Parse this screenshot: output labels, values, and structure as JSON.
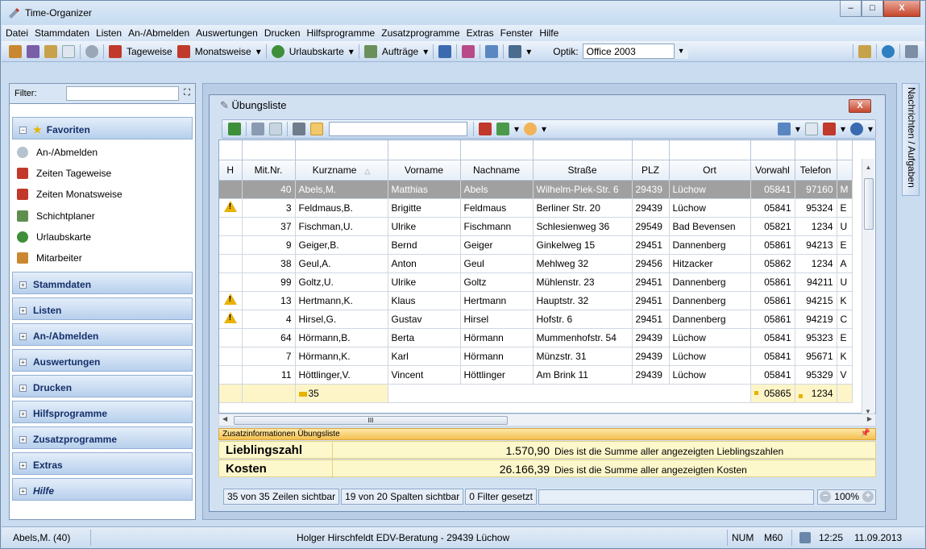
{
  "window": {
    "title": "Time-Organizer",
    "minimize": "–",
    "maximize": "□",
    "close": "X"
  },
  "menu": [
    "Datei",
    "Stammdaten",
    "Listen",
    "An-/Abmelden",
    "Auswertungen",
    "Drucken",
    "Hilfsprogramme",
    "Zusatzprogramme",
    "Extras",
    "Fenster",
    "Hilfe"
  ],
  "toolbar": {
    "tageweise": "Tageweise",
    "monatsweise": "Monatsweise",
    "urlaubskarte": "Urlaubskarte",
    "auftraege": "Aufträge",
    "optik_label": "Optik:",
    "optik_value": "Office 2003"
  },
  "sidebar": {
    "filter_label": "Filter:",
    "favoriten": "Favoriten",
    "fav_items": [
      "An-/Abmelden",
      "Zeiten Tageweise",
      "Zeiten Monatsweise",
      "Schichtplaner",
      "Urlaubskarte",
      "Mitarbeiter"
    ],
    "groups": [
      "Stammdaten",
      "Listen",
      "An-/Abmelden",
      "Auswertungen",
      "Drucken",
      "Hilfsprogramme",
      "Zusatzprogramme",
      "Extras",
      "Hilfe"
    ]
  },
  "side_tab": "Nachrichten / Aufgaben",
  "child": {
    "title": "Übungsliste",
    "close": "X"
  },
  "grid": {
    "columns": [
      "H",
      "Mit.Nr.",
      "Kurzname",
      "Vorname",
      "Nachname",
      "Straße",
      "PLZ",
      "Ort",
      "Vorwahl",
      "Telefon"
    ],
    "rows": [
      {
        "h": "",
        "nr": "40",
        "kurz": "Abels,M.",
        "vor": "Matthias",
        "nach": "Abels",
        "str": "Wilhelm-Piek-Str. 6",
        "plz": "29439",
        "ort": "Lüchow",
        "vw": "05841",
        "tel": "97160",
        "x": "M"
      },
      {
        "h": "warn",
        "nr": "3",
        "kurz": "Feldmaus,B.",
        "vor": "Brigitte",
        "nach": "Feldmaus",
        "str": "Berliner Str. 20",
        "plz": "29439",
        "ort": "Lüchow",
        "vw": "05841",
        "tel": "95324",
        "x": "E"
      },
      {
        "h": "",
        "nr": "37",
        "kurz": "Fischman,U.",
        "vor": "Ulrike",
        "nach": "Fischmann",
        "str": "Schlesienweg 36",
        "plz": "29549",
        "ort": "Bad Bevensen",
        "vw": "05821",
        "tel": "1234",
        "x": "U"
      },
      {
        "h": "",
        "nr": "9",
        "kurz": "Geiger,B.",
        "vor": "Bernd",
        "nach": "Geiger",
        "str": "Ginkelweg 15",
        "plz": "29451",
        "ort": "Dannenberg",
        "vw": "05861",
        "tel": "94213",
        "x": "E"
      },
      {
        "h": "",
        "nr": "38",
        "kurz": "Geul,A.",
        "vor": "Anton",
        "nach": "Geul",
        "str": "Mehlweg 32",
        "plz": "29456",
        "ort": "Hitzacker",
        "vw": "05862",
        "tel": "1234",
        "x": "A"
      },
      {
        "h": "",
        "nr": "99",
        "kurz": "Goltz,U.",
        "vor": "Ulrike",
        "nach": "Goltz",
        "str": "Mühlenstr. 23",
        "plz": "29451",
        "ort": "Dannenberg",
        "vw": "05861",
        "tel": "94211",
        "x": "U"
      },
      {
        "h": "warn",
        "nr": "13",
        "kurz": "Hertmann,K.",
        "vor": "Klaus",
        "nach": "Hertmann",
        "str": "Hauptstr. 32",
        "plz": "29451",
        "ort": "Dannenberg",
        "vw": "05861",
        "tel": "94215",
        "x": "K"
      },
      {
        "h": "warn",
        "nr": "4",
        "kurz": "Hirsel,G.",
        "vor": "Gustav",
        "nach": "Hirsel",
        "str": "Hofstr. 6",
        "plz": "29451",
        "ort": "Dannenberg",
        "vw": "05861",
        "tel": "94219",
        "x": "C"
      },
      {
        "h": "",
        "nr": "64",
        "kurz": "Hörmann,B.",
        "vor": "Berta",
        "nach": "Hörmann",
        "str": "Mummenhofstr. 54",
        "plz": "29439",
        "ort": "Lüchow",
        "vw": "05841",
        "tel": "95323",
        "x": "E"
      },
      {
        "h": "",
        "nr": "7",
        "kurz": "Hörmann,K.",
        "vor": "Karl",
        "nach": "Hörmann",
        "str": "Münzstr. 31",
        "plz": "29439",
        "ort": "Lüchow",
        "vw": "05841",
        "tel": "95671",
        "x": "K"
      },
      {
        "h": "",
        "nr": "11",
        "kurz": "Höttlinger,V.",
        "vor": "Vincent",
        "nach": "Höttlinger",
        "str": "Am Brink 11",
        "plz": "29439",
        "ort": "Lüchow",
        "vw": "05841",
        "tel": "95329",
        "x": "V"
      }
    ],
    "summary": {
      "count": "35",
      "vorwahl": "05865",
      "telefon": "1234"
    },
    "hscroll_grip": "III"
  },
  "zusatz": {
    "header": "Zusatzinformationen Übungsliste",
    "pin": "ᵖ",
    "rows": [
      {
        "label": "Lieblingszahl",
        "value": "1.570,90",
        "desc": "Dies ist die Summe aller angezeigten Lieblingszahlen"
      },
      {
        "label": "Kosten",
        "value": "26.166,39",
        "desc": "Dies ist die Summe aller angezeigten Kosten"
      }
    ]
  },
  "inner_status": {
    "rows": "35 von 35 Zeilen sichtbar",
    "cols": "19 von 20 Spalten sichtbar",
    "filter": "0 Filter gesetzt",
    "zoom": "100%"
  },
  "statusbar": {
    "user": "Abels,M. (40)",
    "company": "Holger Hirschfeldt EDV-Beratung - 29439 Lüchow",
    "num": "NUM",
    "m": "M60",
    "time": "12:25",
    "date": "11.09.2013"
  },
  "colors": {
    "warn": "#e9b200",
    "selected_row": "#a0a0a0",
    "summary_bg": "#fdf5c8",
    "zusatz_header": "#f5c04f"
  }
}
